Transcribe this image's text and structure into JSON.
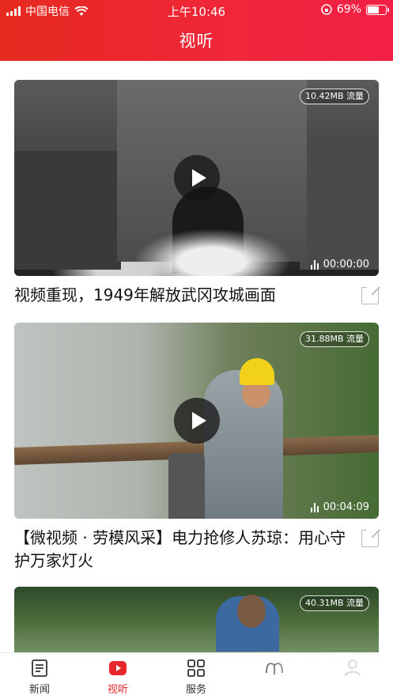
{
  "status_bar": {
    "carrier": "中国电信",
    "time": "上午10:46",
    "battery": "69%",
    "battery_level": 0.69
  },
  "header": {
    "title": "视听"
  },
  "videos": [
    {
      "traffic": "10.42MB 流量",
      "duration": "00:00:00",
      "title": "视频重现，1949年解放武冈攻城画面"
    },
    {
      "traffic": "31.88MB 流量",
      "duration": "00:04:09",
      "title": "【微视频 · 劳模风采】电力抢修人苏琼：用心守护万家灯火"
    },
    {
      "traffic": "40.31MB 流量"
    }
  ],
  "tabbar": {
    "items": [
      {
        "label": "新闻",
        "icon": "news-icon"
      },
      {
        "label": "视听",
        "icon": "video-play-icon",
        "active": true
      },
      {
        "label": "服务",
        "icon": "grid-icon"
      },
      {
        "label": "",
        "icon": "book-icon"
      },
      {
        "label": "",
        "icon": "user-icon"
      }
    ]
  },
  "colors": {
    "brand": "#e6282c"
  }
}
